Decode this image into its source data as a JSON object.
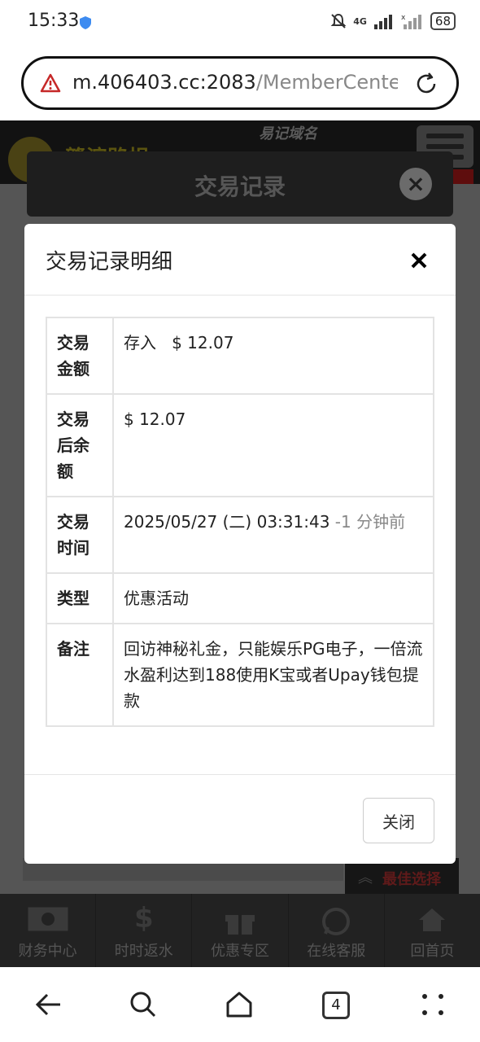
{
  "status_bar": {
    "time": "15:33",
    "network": "4G",
    "battery": "68"
  },
  "address_bar": {
    "host": "m.406403.cc:2083",
    "path": "/MemberCenter"
  },
  "background": {
    "domain_label": "易记域名",
    "brand_text": "赣滨路损",
    "header_title": "交易记录",
    "best_choice": "最佳选择",
    "tabs": [
      {
        "label": "财务中心",
        "icon": "money-icon"
      },
      {
        "label": "时时返水",
        "icon": "dollar-icon"
      },
      {
        "label": "优惠专区",
        "icon": "gift-icon"
      },
      {
        "label": "在线客服",
        "icon": "whatsapp-icon"
      },
      {
        "label": "回首页",
        "icon": "home-icon"
      }
    ]
  },
  "modal": {
    "title": "交易记录明细",
    "rows": {
      "amount": {
        "key": "交易金额",
        "type": "存入",
        "value": "$ 12.07"
      },
      "balance": {
        "key": "交易后余额",
        "value": "$ 12.07"
      },
      "time": {
        "key": "交易时间",
        "value": "2025/05/27 (二) 03:31:43",
        "relative": "-1 分钟前"
      },
      "category": {
        "key": "类型",
        "value": "优惠活动"
      },
      "note": {
        "key": "备注",
        "value": "回访神秘礼金，只能娱乐PG电子，一倍流水盈利达到188使用K宝或者Upay钱包提款"
      }
    },
    "close_button": "关闭"
  },
  "browser_nav": {
    "tab_count": "4"
  },
  "colors": {
    "deposit_green": "#3c763d",
    "overlay": "#121212"
  }
}
